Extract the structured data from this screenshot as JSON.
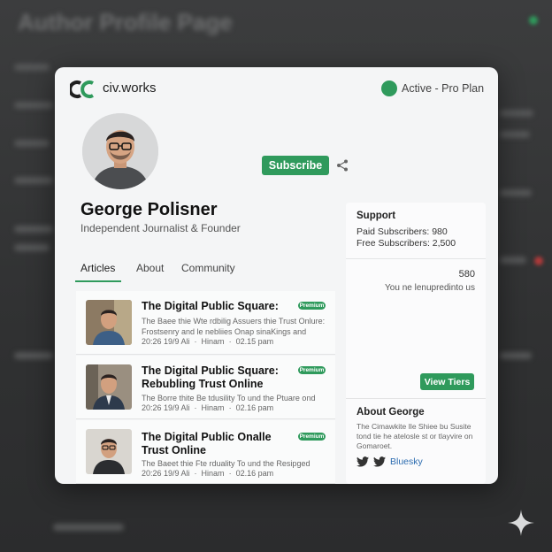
{
  "backdrop": {
    "title": "Author Profile Page"
  },
  "header": {
    "brand": "civ.works",
    "status": "Active - Pro Plan",
    "accent_color": "#2f9a5c"
  },
  "profile": {
    "name": "George Polisner",
    "role": "Independent Journalist & Founder",
    "subscribe_label": "Subscribe"
  },
  "tabs": [
    {
      "label": "Articles",
      "active": true
    },
    {
      "label": "About",
      "active": false
    },
    {
      "label": "Community",
      "active": false
    }
  ],
  "articles": [
    {
      "title": "The Digital Public Square:",
      "badge": "Premium",
      "desc1": "The Baee thie Wte rdbilig Assuers thie Trust Onlure:",
      "desc2": "Frostsenry and le nebliies Onap sinaKings and",
      "meta_date": "20:26 19/9 Ali",
      "meta_author": "Hinam",
      "meta_time": "02.15 pam"
    },
    {
      "title": "The Digital Public Square: Rebubling Trust Online",
      "badge": "Premium",
      "desc1": "The Borre thite Be tdusility To und the Ptuare ond",
      "meta_date": "20:26 19/9 Ali",
      "meta_author": "Hinam",
      "meta_time": "02.16 pam"
    },
    {
      "title": "The Digital Public Onalle Trust Online",
      "badge": "Premium",
      "desc1": "The Baeet thie Fte rduality To und the Resipged",
      "meta_date": "20:26 19/9 Ali",
      "meta_author": "Hinam",
      "meta_time": "02.16 pam"
    }
  ],
  "sidebar": {
    "support_heading": "Support",
    "paid_subscribers": "Paid Subscribers: 980",
    "free_subscribers": "Free Subscribers: 2,500",
    "count": "580",
    "count_caption": "You ne lenupredinto us",
    "view_tiers_label": "View Tiers",
    "about_heading": "About George",
    "about_text": "The Cimawkite Ile Shiee bu Susite tond tie he atelosle st or tlayvire on Gomaroet.",
    "social_link": "Bluesky"
  }
}
